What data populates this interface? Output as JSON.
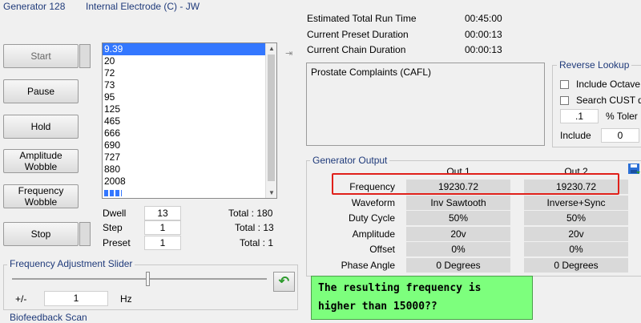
{
  "header": {
    "generator": "Generator 128",
    "electrode": "Internal Electrode (C) - JW"
  },
  "buttons": {
    "start": "Start",
    "pause": "Pause",
    "hold": "Hold",
    "amp1": "Amplitude",
    "amp2": "Wobble",
    "freq1": "Frequency",
    "freq2": "Wobble",
    "stop": "Stop"
  },
  "frequency_list": [
    "9.39",
    "20",
    "72",
    "73",
    "95",
    "125",
    "465",
    "666",
    "690",
    "727",
    "880",
    "2008"
  ],
  "counters": {
    "dwell_label": "Dwell",
    "dwell": "13",
    "dwell_total": "Total : 180",
    "step_label": "Step",
    "step": "1",
    "step_total": "Total : 13",
    "preset_label": "Preset",
    "preset": "1",
    "preset_total": "Total : 1"
  },
  "run": {
    "est_label": "Estimated Total Run Time",
    "est": "00:45:00",
    "preset_label": "Current Preset Duration",
    "preset": "00:00:13",
    "chain_label": "Current Chain Duration",
    "chain": "00:00:13"
  },
  "program_name": "Prostate Complaints (CAFL)",
  "reverse_lookup": {
    "title": "Reverse Lookup",
    "include_octave": "Include Octave",
    "search_cust": "Search CUST d",
    "tolerance_value": ".1",
    "tolerance_label": "% Toler",
    "include_label": "Include",
    "include_value": "0"
  },
  "generator_output": {
    "title": "Generator Output",
    "out1": "Out 1",
    "out2": "Out 2",
    "rows": [
      {
        "label": "Frequency",
        "v1": "19230.72",
        "v2": "19230.72"
      },
      {
        "label": "Waveform",
        "v1": "Inv Sawtooth",
        "v2": "Inverse+Sync"
      },
      {
        "label": "Duty Cycle",
        "v1": "50%",
        "v2": "50%"
      },
      {
        "label": "Amplitude",
        "v1": "20v",
        "v2": "20v"
      },
      {
        "label": "Offset",
        "v1": "0%",
        "v2": "0%"
      },
      {
        "label": "Phase Angle",
        "v1": "0 Degrees",
        "v2": "0 Degrees"
      }
    ]
  },
  "slider": {
    "title": "Frequency Adjustment Slider",
    "pm_label": "+/-",
    "value": "1",
    "unit": "Hz",
    "level": 0.53
  },
  "annotation": {
    "line1": "The resulting frequency is",
    "line2": "higher than 15000??"
  },
  "bottom_label": "Biofeedback Scan",
  "colors": {
    "highlight_box": "#e0201a",
    "annotation_bg": "#7dff7d",
    "list_selection": "#3377ff",
    "legend_text": "#1f3a7a"
  }
}
